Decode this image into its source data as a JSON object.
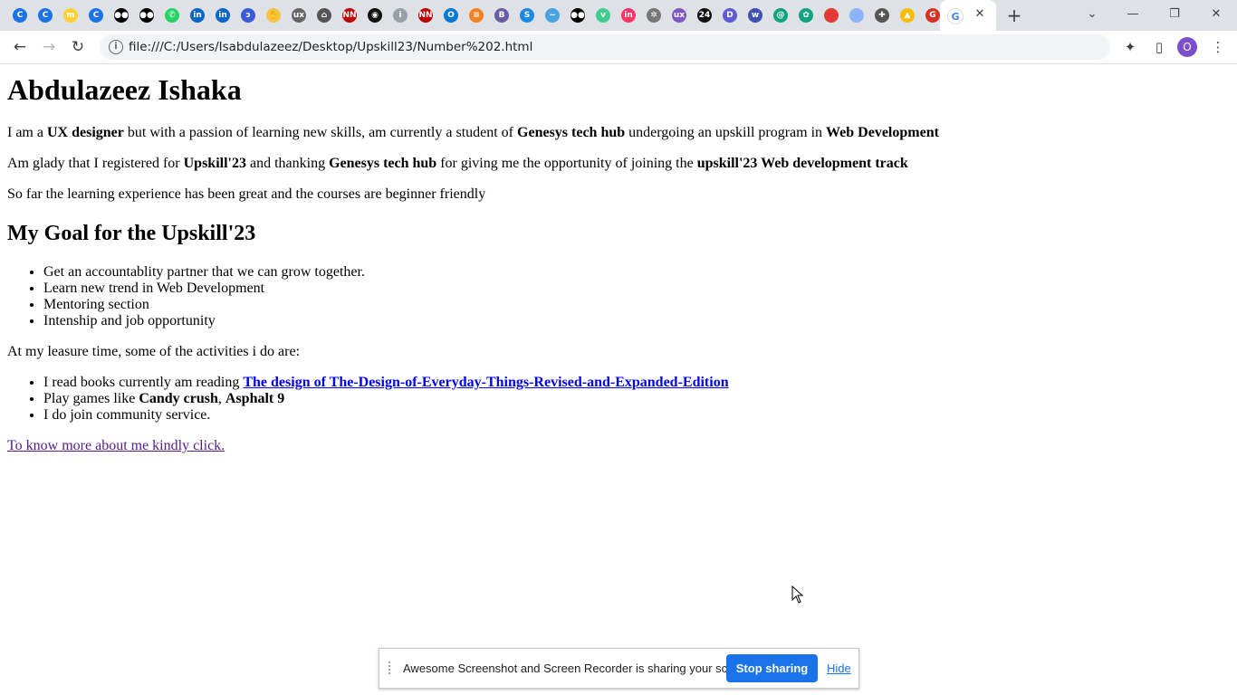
{
  "browser": {
    "tabs": [
      {
        "icon": "c-icon",
        "color": "#1a73e8"
      },
      {
        "icon": "c-icon",
        "color": "#1a73e8"
      },
      {
        "icon": "miro-icon",
        "color": "#ffd02f"
      },
      {
        "icon": "c-icon",
        "color": "#1a73e8"
      },
      {
        "icon": "medium-icon",
        "color": "#000000"
      },
      {
        "icon": "medium-icon",
        "color": "#000000"
      },
      {
        "icon": "whatsapp-icon",
        "color": "#25d366"
      },
      {
        "icon": "linkedin-icon",
        "color": "#0a66c2"
      },
      {
        "icon": "linkedin-icon",
        "color": "#0a66c2"
      },
      {
        "icon": "swirl-icon",
        "color": "#3b5bdb"
      },
      {
        "icon": "hand-icon",
        "color": "#f5c542"
      },
      {
        "icon": "ux-icon",
        "color": "#666666"
      },
      {
        "icon": "airbnb-icon",
        "color": "#555555"
      },
      {
        "icon": "nn-icon",
        "color": "#c00000"
      },
      {
        "icon": "camera-icon",
        "color": "#111111"
      },
      {
        "icon": "circle-i-icon",
        "color": "#9aa0a6"
      },
      {
        "icon": "nn-icon",
        "color": "#c00000"
      },
      {
        "icon": "outlook-icon",
        "color": "#0078d4"
      },
      {
        "icon": "stack-icon",
        "color": "#f48024"
      },
      {
        "icon": "book-icon",
        "color": "#6b5ca5"
      },
      {
        "icon": "s-icon",
        "color": "#1e88e5"
      },
      {
        "icon": "wave-icon",
        "color": "#4aa3df"
      },
      {
        "icon": "medium-icon",
        "color": "#000000"
      },
      {
        "icon": "v-icon",
        "color": "#3ecf8e"
      },
      {
        "icon": "invision-icon",
        "color": "#ff3366"
      },
      {
        "icon": "gear-icon",
        "color": "#777777"
      },
      {
        "icon": "ux-icon",
        "color": "#7e57c2"
      },
      {
        "icon": "24-icon",
        "color": "#111111"
      },
      {
        "icon": "d-icon",
        "color": "#5b5bd6"
      },
      {
        "icon": "w-icon",
        "color": "#3f51b5"
      },
      {
        "icon": "spiral-icon",
        "color": "#10a37f"
      },
      {
        "icon": "chatgpt-icon",
        "color": "#10a37f"
      },
      {
        "icon": "red-dot-icon",
        "color": "#e53935"
      },
      {
        "icon": "blue-dot-icon",
        "color": "#8ab4f8"
      },
      {
        "icon": "puzzle-gray-icon",
        "color": "#555555"
      },
      {
        "icon": "drive-icon",
        "color": "#fbbc04"
      },
      {
        "icon": "g-red-icon",
        "color": "#d93025"
      }
    ],
    "active_tab_icon": "google-icon",
    "url": "file:///C:/Users/Isabdulazeez/Desktop/Upskill23/Number%202.html",
    "profile_initial": "O"
  },
  "page": {
    "h1": "Abdulazeez Ishaka",
    "p1": {
      "t1": "I am a ",
      "b1": "UX designer",
      "t2": " but with a passion of learning new skills, am currently a student of ",
      "b2": "Genesys tech hub",
      "t3": " undergoing an upskill program in ",
      "b3": "Web Development"
    },
    "p2": {
      "t1": "Am glady that I registered for ",
      "b1": "Upskill'23",
      "t2": " and thanking ",
      "b2": "Genesys tech hub",
      "t3": " for giving me the opportunity of joining the ",
      "b3": "upskill'23 Web development track"
    },
    "p3": "So far the learning experience has been great and the courses are beginner friendly",
    "h2": "My Goal for the Upskill'23",
    "goals": [
      "Get an accountablity partner that we can grow together.",
      "Learn new trend in Web Development",
      "Mentoring section",
      "Intenship and job opportunity"
    ],
    "p4": "At my leasure time, some of the activities i do are:",
    "activities": {
      "a1_text": "I read books currently am reading ",
      "a1_link": "The design of The-Design-of-Everyday-Things-Revised-and-Expanded-Edition",
      "a2_text": "Play games like ",
      "a2_b1": "Candy crush",
      "a2_sep": ", ",
      "a2_b2": "Asphalt 9",
      "a3_text": "I do join community service."
    },
    "more_link": "To know more about me kindly click."
  },
  "sharebar": {
    "message": "Awesome Screenshot and Screen Recorder is sharing your screen.",
    "stop_label": "Stop sharing",
    "hide_label": "Hide"
  }
}
